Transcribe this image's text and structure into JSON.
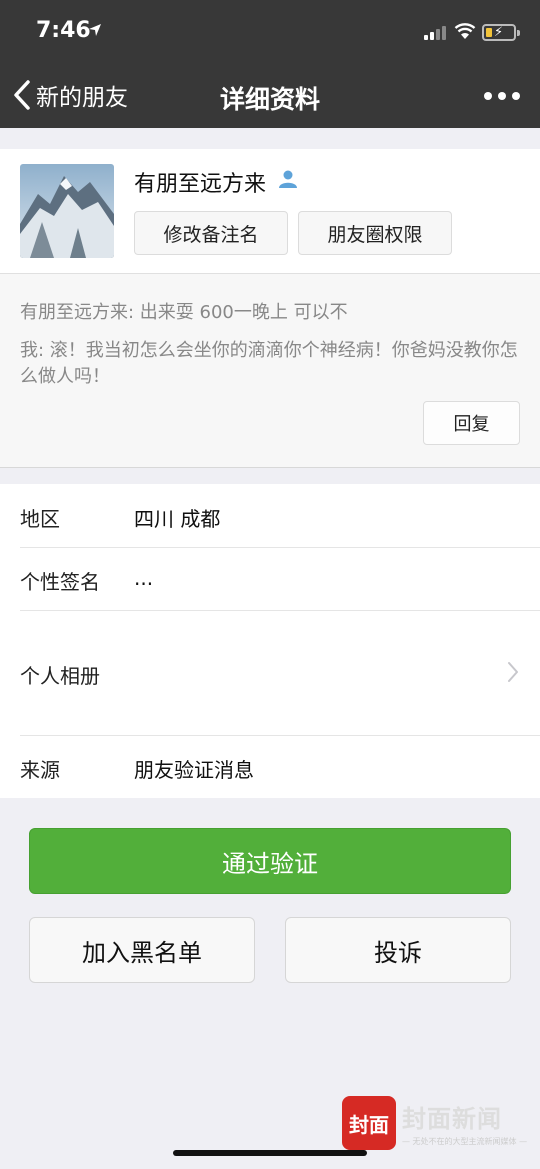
{
  "status": {
    "time": "7:46"
  },
  "nav": {
    "back_label": "新的朋友",
    "title": "详细资料"
  },
  "profile": {
    "name": "有朋至远方来",
    "remark_button": "修改备注名",
    "moments_button": "朋友圈权限"
  },
  "messages": {
    "from_them": "有朋至远方来: 出来耍 600一晚上 可以不",
    "from_me": "我: 滚！我当初怎么会坐你的滴滴你个神经病！你爸妈没教你怎么做人吗！",
    "reply_button": "回复"
  },
  "info": {
    "region_label": "地区",
    "region_value": "四川 成都",
    "signature_label": "个性签名",
    "signature_value": "...",
    "album_label": "个人相册",
    "source_label": "来源",
    "source_value": "朋友验证消息"
  },
  "actions": {
    "verify": "通过验证",
    "blacklist": "加入黑名单",
    "complain": "投诉"
  },
  "watermark": {
    "logo_text": "封面",
    "name": "封面新闻",
    "subtitle": "— 无处不在的大型主流新闻媒体 —"
  },
  "colors": {
    "nav_bg": "#383838",
    "verify_green": "#52af3a",
    "page_bg": "#efeff4"
  }
}
